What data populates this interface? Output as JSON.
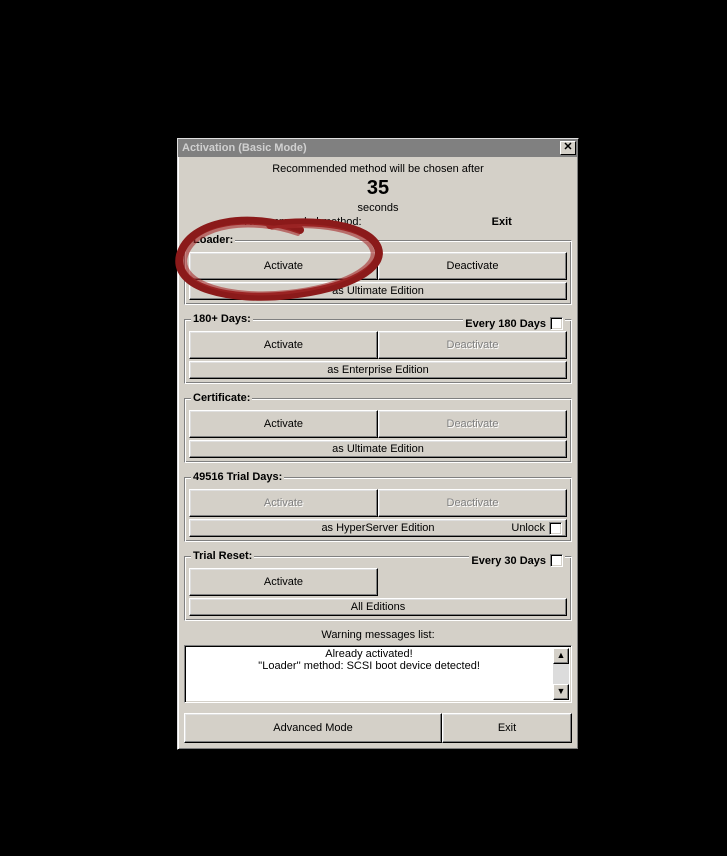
{
  "window": {
    "title": "Activation (Basic Mode)"
  },
  "header": {
    "line1": "Recommended method will be chosen after",
    "counter": "35",
    "seconds": "seconds",
    "recmethod_label": "Recommended method:",
    "exit": "Exit"
  },
  "groups": {
    "loader": {
      "legend": "Loader:",
      "activate": "Activate",
      "deactivate": "Deactivate",
      "status": "as Ultimate Edition"
    },
    "days180": {
      "legend": "180+ Days:",
      "right": "Every 180 Days",
      "activate": "Activate",
      "deactivate": "Deactivate",
      "status": "as Enterprise Edition"
    },
    "certificate": {
      "legend": "Certificate:",
      "activate": "Activate",
      "deactivate": "Deactivate",
      "status": "as Ultimate Edition"
    },
    "trialdays": {
      "legend": "49516 Trial Days:",
      "activate": "Activate",
      "deactivate": "Deactivate",
      "status": "as HyperServer Edition",
      "unlock": "Unlock"
    },
    "trialreset": {
      "legend": "Trial Reset:",
      "right": "Every 30 Days",
      "activate": "Activate",
      "status": "All Editions"
    }
  },
  "warnings": {
    "label": "Warning messages list:",
    "line1": "Already activated!",
    "line2": "''Loader'' method: SCSI boot device detected!"
  },
  "bottom": {
    "advanced": "Advanced Mode",
    "exit": "Exit"
  }
}
